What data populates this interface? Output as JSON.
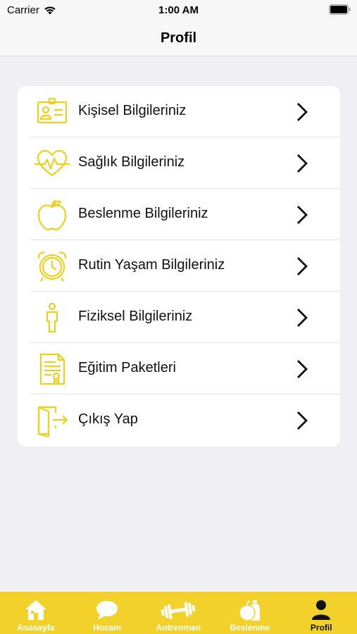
{
  "status_bar": {
    "carrier": "Carrier",
    "time": "1:00 AM"
  },
  "header": {
    "title": "Profil"
  },
  "menu": {
    "items": [
      {
        "label": "Kişisel Bilgileriniz",
        "icon": "id-card-icon"
      },
      {
        "label": "Sağlık Bilgileriniz",
        "icon": "heart-pulse-icon"
      },
      {
        "label": "Beslenme Bilgileriniz",
        "icon": "apple-icon"
      },
      {
        "label": "Rutin Yaşam Bilgileriniz",
        "icon": "alarm-clock-icon"
      },
      {
        "label": "Fiziksel Bilgileriniz",
        "icon": "person-icon"
      },
      {
        "label": "Eğitim Paketleri",
        "icon": "certificate-icon"
      },
      {
        "label": "Çıkış Yap",
        "icon": "logout-door-icon"
      }
    ]
  },
  "tab_bar": {
    "tabs": [
      {
        "label": "Anasayfa",
        "icon": "home-icon"
      },
      {
        "label": "Hocam",
        "icon": "chat-bubble-icon"
      },
      {
        "label": "Antrenman",
        "icon": "dumbbell-icon"
      },
      {
        "label": "Beslenme",
        "icon": "nutrition-icon"
      },
      {
        "label": "Profil",
        "icon": "user-icon",
        "active": true
      }
    ]
  },
  "colors": {
    "accent": "#f2d22a",
    "icon_yellow": "#f0cf1c",
    "background": "#efeff4"
  }
}
